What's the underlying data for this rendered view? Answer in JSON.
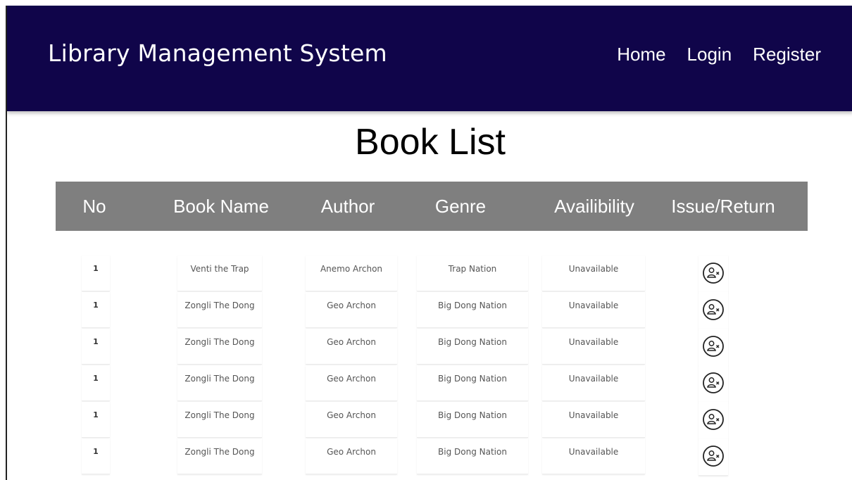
{
  "navbar": {
    "brand": "Library Management System",
    "links": [
      "Home",
      "Login",
      "Register"
    ],
    "background_color": "#10054a"
  },
  "page": {
    "title": "Book List"
  },
  "table": {
    "header_color": "#7f7f7f",
    "columns": [
      "No",
      "Book Name",
      "Author",
      "Genre",
      "Availibility",
      "Issue/Return"
    ],
    "rows": [
      {
        "no": "1",
        "book_name": "Venti the Trap",
        "author": "Anemo Archon",
        "genre": "Trap Nation",
        "availability": "Unavailable",
        "action_icon": "user-remove-icon"
      },
      {
        "no": "1",
        "book_name": "Zongli The Dong",
        "author": "Geo Archon",
        "genre": "Big Dong Nation",
        "availability": "Unavailable",
        "action_icon": "user-remove-icon"
      },
      {
        "no": "1",
        "book_name": "Zongli The Dong",
        "author": "Geo Archon",
        "genre": "Big Dong Nation",
        "availability": "Unavailable",
        "action_icon": "user-remove-icon"
      },
      {
        "no": "1",
        "book_name": "Zongli The Dong",
        "author": "Geo Archon",
        "genre": "Big Dong Nation",
        "availability": "Unavailable",
        "action_icon": "user-remove-icon"
      },
      {
        "no": "1",
        "book_name": "Zongli The Dong",
        "author": "Geo Archon",
        "genre": "Big Dong Nation",
        "availability": "Unavailable",
        "action_icon": "user-remove-icon"
      },
      {
        "no": "1",
        "book_name": "Zongli The Dong",
        "author": "Geo Archon",
        "genre": "Big Dong Nation",
        "availability": "Unavailable",
        "action_icon": "user-remove-icon"
      }
    ]
  }
}
